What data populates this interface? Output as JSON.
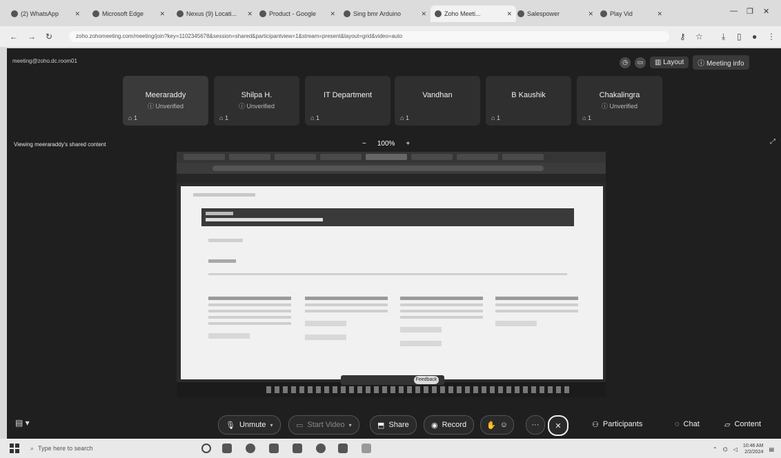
{
  "browser": {
    "tabs": [
      "(2) WhatsApp",
      "Microsoft Edge",
      "Nexus (9) Locati...",
      "Product - Google",
      "Sing bmr Arduino",
      "Zoho Meeti...",
      "Salespower",
      "Play Vid"
    ],
    "active_tab_index": 5,
    "url": "zoho.zohomeeting.com/meeting/join?key=1102345678&session=shared&participantview=1&stream=present&layout=grid&video=auto",
    "window_controls": [
      "—",
      "❐",
      "✕"
    ]
  },
  "meeting": {
    "title": "meeting@zoho.dc.room01",
    "top_right": {
      "layout_label": "Layout",
      "meeting_info_label": "Meeting info"
    },
    "participants": [
      {
        "name": "Meeraraddy",
        "status": "Unverified",
        "count": "1"
      },
      {
        "name": "Shilpa H.",
        "status": "Unverified",
        "count": "1"
      },
      {
        "name": "IT Department",
        "status": "",
        "count": "1"
      },
      {
        "name": "Vandhan",
        "status": "",
        "count": "1"
      },
      {
        "name": "B Kaushik",
        "status": "",
        "count": "1"
      },
      {
        "name": "Chakalingra",
        "status": "Unverified",
        "count": "1"
      }
    ],
    "viewing_label": "Viewing meeraraddy's shared content",
    "zoom": {
      "minus": "−",
      "value": "100%",
      "plus": "+"
    },
    "shared_screen": {
      "feedback_label": "Feedback"
    },
    "controls": {
      "unmute": "Unmute",
      "start_video": "Start Video",
      "share": "Share",
      "record": "Record",
      "more": "···",
      "participants": "Participants",
      "chat": "Chat",
      "content": "Content"
    }
  },
  "taskbar": {
    "search_placeholder": "Type here to search",
    "time": "10:46 AM",
    "date": "2/2/2024"
  }
}
